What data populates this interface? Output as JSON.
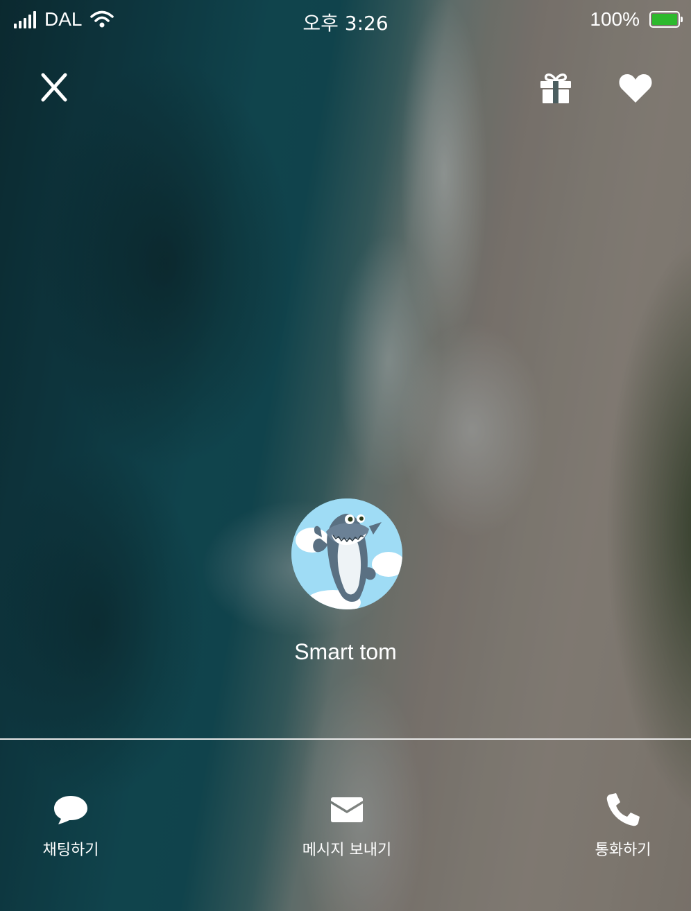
{
  "status_bar": {
    "carrier": "DAL",
    "time": "오후 3:26",
    "battery_percent": "100%",
    "battery_level": 1.0,
    "battery_color": "#2db92d"
  },
  "top_bar": {
    "close_icon": "close-icon",
    "gift_icon": "gift-icon",
    "heart_icon": "heart-icon"
  },
  "profile": {
    "name": "Smart tom",
    "avatar": "shark-avatar"
  },
  "actions": [
    {
      "label": "채팅하기",
      "icon": "chat-bubble-icon"
    },
    {
      "label": "메시지 보내기",
      "icon": "envelope-icon"
    },
    {
      "label": "통화하기",
      "icon": "phone-icon"
    }
  ]
}
